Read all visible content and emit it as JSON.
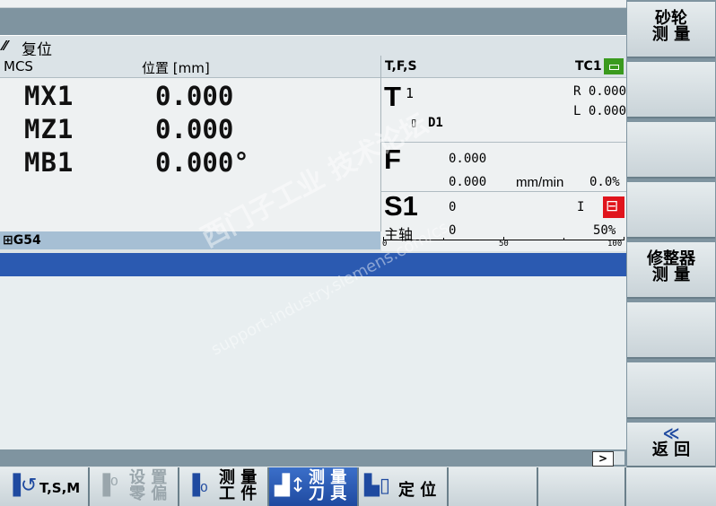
{
  "header": {
    "status_symbol": "⁄⁄",
    "status_text": "复位"
  },
  "position_panel": {
    "col_system": "MCS",
    "col_position": "位置 [mm]",
    "axes": [
      {
        "name": "MX1",
        "value": "0.000"
      },
      {
        "name": "MZ1",
        "value": "0.000"
      },
      {
        "name": "MB1",
        "value": "0.000°"
      }
    ],
    "frame": "G54"
  },
  "tfs_panel": {
    "title": "T,F,S",
    "channel": "TC1",
    "tool": {
      "letter": "T",
      "number": "1",
      "d_label": "D1",
      "r_label": "R 0.000",
      "l_label": "L 0.000"
    },
    "feed": {
      "letter": "F",
      "value1": "0.000",
      "value2": "0.000",
      "unit": "mm/min",
      "override": "0.0%"
    },
    "spindle": {
      "name": "S1",
      "sub_label": "主轴",
      "value1": "0",
      "value2": "0",
      "direction": "I",
      "override": "50%",
      "scale": [
        "0",
        "50",
        "100"
      ]
    }
  },
  "scroll": {
    "next_label": ">"
  },
  "vertical_softkeys": [
    {
      "line1": "砂轮",
      "line2": "测 量"
    },
    {
      "line1": "",
      "line2": ""
    },
    {
      "line1": "",
      "line2": ""
    },
    {
      "line1": "",
      "line2": ""
    },
    {
      "line1": "修整器",
      "line2": "测 量"
    },
    {
      "line1": "",
      "line2": ""
    },
    {
      "line1": "",
      "line2": ""
    },
    {
      "line1": "≪",
      "line2": "返 回"
    }
  ],
  "horizontal_softkeys": [
    {
      "label": "T,S,M",
      "state": "normal"
    },
    {
      "label": "设 置 零 偏",
      "state": "disabled"
    },
    {
      "label": "测 量 工 件",
      "state": "normal"
    },
    {
      "label": "测 量 刀 具",
      "state": "active"
    },
    {
      "label": "定 位",
      "state": "normal"
    },
    {
      "label": "",
      "state": "normal"
    },
    {
      "label": "",
      "state": "normal"
    }
  ],
  "watermark": {
    "line1": "西门子工业  技术论坛",
    "line2": "support.industry.siemens.com/cs"
  },
  "colors": {
    "accent_blue": "#2b5ab1",
    "spindle_red": "#e0141c",
    "channel_green": "#3a9a1e"
  }
}
